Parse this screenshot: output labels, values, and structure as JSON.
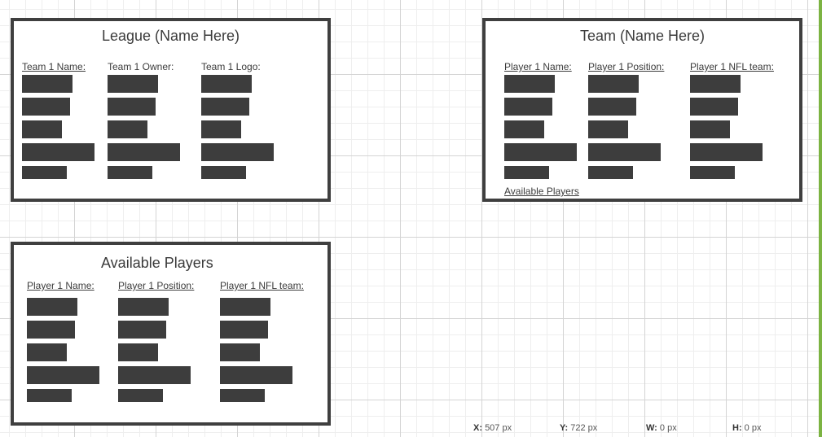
{
  "league_panel": {
    "title": "League (Name Here)",
    "columns": [
      "Team 1 Name:",
      "Team 1 Owner:",
      "Team 1 Logo:"
    ]
  },
  "team_panel": {
    "title": "Team (Name Here)",
    "columns": [
      "Player 1 Name:",
      "Player 1 Position:",
      "Player 1 NFL team:"
    ],
    "link": "Available Players"
  },
  "available_panel": {
    "title": "Available Players",
    "columns": [
      "Player 1 Name:",
      "Player 1 Position:",
      "Player 1 NFL team:"
    ]
  },
  "status_bar": {
    "x_label": "X:",
    "x_value": "507 px",
    "y_label": "Y:",
    "y_value": "722 px",
    "w_label": "W:",
    "w_value": "0 px",
    "h_label": "H:",
    "h_value": "0 px"
  },
  "colors": {
    "frame_border": "#3f3f3f",
    "placeholder_bar": "#3d3d3d",
    "accent_edge": "#7cb342",
    "grid_major": "#d4d4d4",
    "grid_minor": "#eeeeee"
  }
}
